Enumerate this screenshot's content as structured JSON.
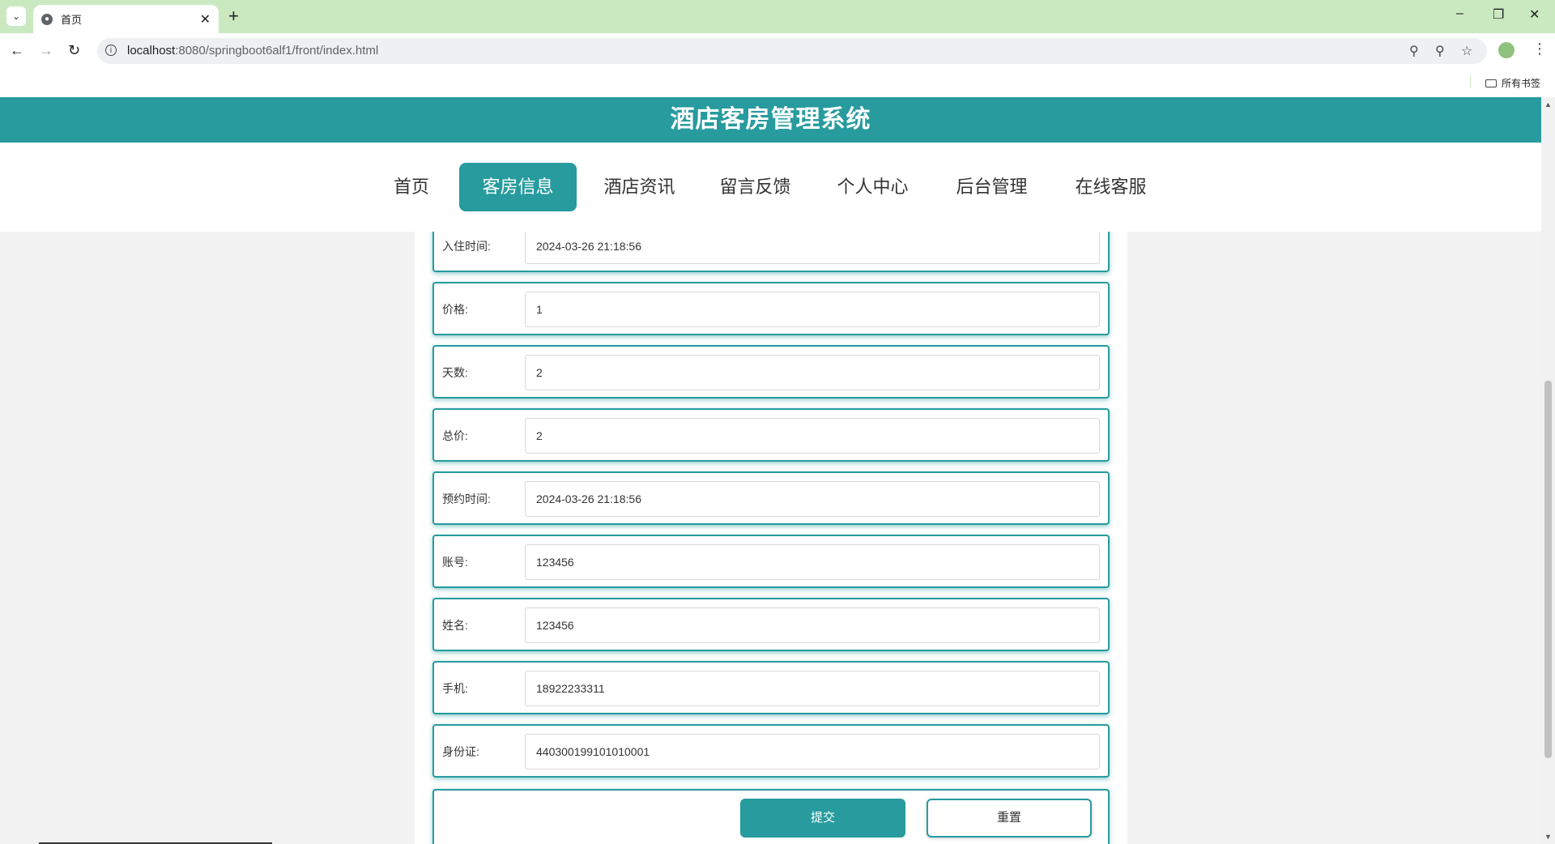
{
  "browser": {
    "tab_title": "首页",
    "url_host": "localhost",
    "url_path": ":8080/springboot6alf1/front/index.html",
    "bookmarks_folder": "所有书签"
  },
  "site": {
    "title": "酒店客房管理系统",
    "nav": [
      {
        "label": "首页",
        "active": false
      },
      {
        "label": "客房信息",
        "active": true
      },
      {
        "label": "酒店资讯",
        "active": false
      },
      {
        "label": "留言反馈",
        "active": false
      },
      {
        "label": "个人中心",
        "active": false
      },
      {
        "label": "后台管理",
        "active": false
      },
      {
        "label": "在线客服",
        "active": false
      }
    ]
  },
  "form": {
    "fields": [
      {
        "label": "入住时间:",
        "value": "2024-03-26 21:18:56"
      },
      {
        "label": "价格:",
        "value": "1"
      },
      {
        "label": "天数:",
        "value": "2"
      },
      {
        "label": "总价:",
        "value": "2"
      },
      {
        "label": "预约时间:",
        "value": "2024-03-26 21:18:56"
      },
      {
        "label": "账号:",
        "value": "123456"
      },
      {
        "label": "姓名:",
        "value": "123456"
      },
      {
        "label": "手机:",
        "value": "18922233311"
      },
      {
        "label": "身份证:",
        "value": "440300199101010001"
      }
    ],
    "submit_label": "提交",
    "reset_label": "重置"
  },
  "colors": {
    "accent": "#279b9e",
    "tabbar": "#cbe9c1"
  }
}
